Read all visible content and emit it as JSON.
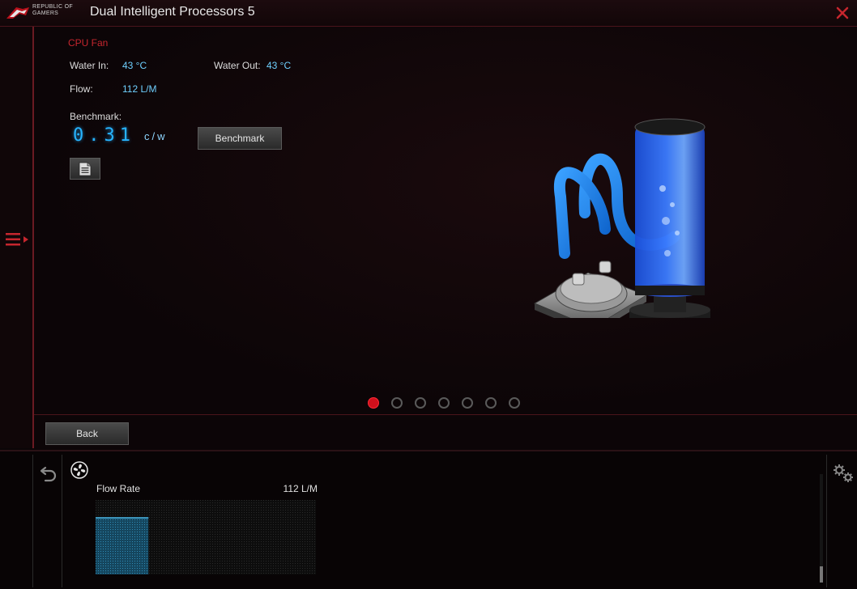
{
  "titlebar": {
    "brand_line1": "REPUBLIC OF",
    "brand_line2": "GAMERS",
    "title": "Dual Intelligent Processors 5"
  },
  "main": {
    "section_title": "CPU Fan",
    "water_in_label": "Water In:",
    "water_in_value": "43 °C",
    "water_out_label": "Water Out:",
    "water_out_value": "43 °C",
    "flow_label": "Flow:",
    "flow_value": "112 L/M",
    "benchmark_label": "Benchmark:",
    "benchmark_value": "0.31",
    "benchmark_unit": "c/w",
    "benchmark_button": "Benchmark",
    "pager": {
      "total": 7,
      "active": 1
    }
  },
  "footer": {
    "back_label": "Back"
  },
  "bottom": {
    "flow_rate_label": "Flow Rate",
    "flow_rate_value": "112 L/M",
    "flow_fill_fraction": 0.24
  },
  "colors": {
    "accent_red": "#c6262e",
    "value_blue": "#6fd0ff",
    "digital_blue": "#27b4ff",
    "chart_fill": "#1f5f7f"
  },
  "icons": {
    "logo": "rog-logo-icon",
    "close": "close-icon",
    "menu": "menu-toggle-icon",
    "document": "document-icon",
    "undo": "undo-icon",
    "fan": "fan-icon",
    "settings": "gear-icon"
  }
}
